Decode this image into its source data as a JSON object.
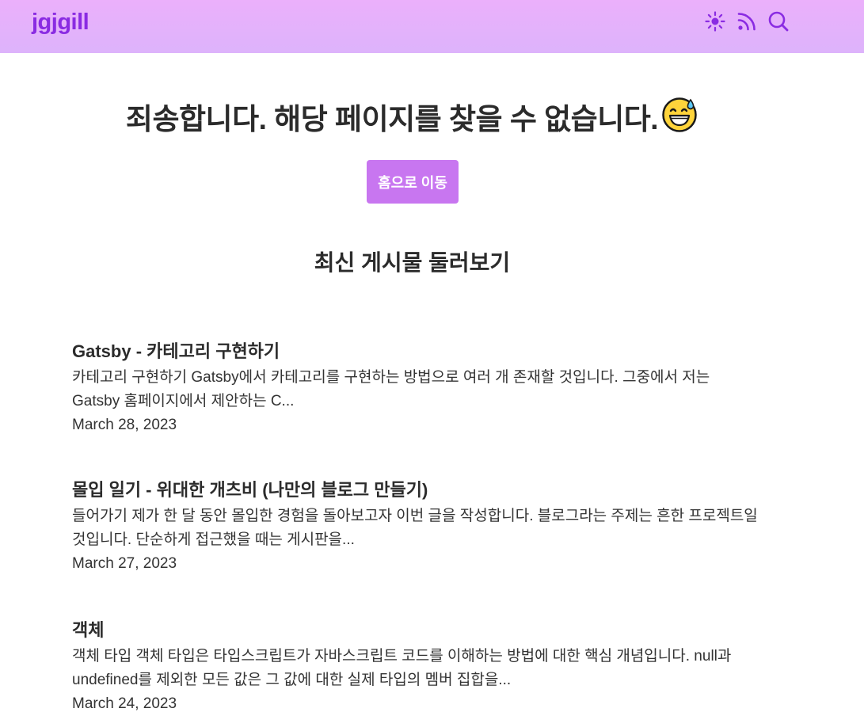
{
  "header": {
    "logo": "jgjgill",
    "icons": [
      "sun-icon",
      "rss-icon",
      "search-icon"
    ],
    "background": "#e7b1fb",
    "accent": "#8a2be2"
  },
  "not_found": {
    "title": "죄송합니다. 해당 페이지를 찾을 수 없습니다.",
    "emoji": "sweat-smile-emoji",
    "home_button": "홈으로 이동",
    "button_color": "#c876f0"
  },
  "recent": {
    "heading": "최신 게시물 둘러보기",
    "posts": [
      {
        "title": "Gatsby - 카테고리 구현하기",
        "excerpt": "카테고리 구현하기 Gatsby에서 카테고리를 구현하는 방법으로 여러 개 존재할 것입니다. 그중에서 저는 Gatsby 홈페이지에서 제안하는 C...",
        "date": "March 28, 2023"
      },
      {
        "title": "몰입 일기 - 위대한 개츠비 (나만의 블로그 만들기)",
        "excerpt": "들어가기 제가 한 달 동안 몰입한 경험을 돌아보고자 이번 글을 작성합니다. 블로그라는 주제는 흔한 프로젝트일 것입니다. 단순하게 접근했을 때는 게시판을...",
        "date": "March 27, 2023"
      },
      {
        "title": "객체",
        "excerpt": "객체 타입 객체 타입은 타입스크립트가 자바스크립트 코드를 이해하는 방법에 대한 핵심 개념입니다. null과 undefined를 제외한 모든 값은 그 값에 대한 실제 타입의 멤버 집합을...",
        "date": "March 24, 2023"
      }
    ]
  }
}
